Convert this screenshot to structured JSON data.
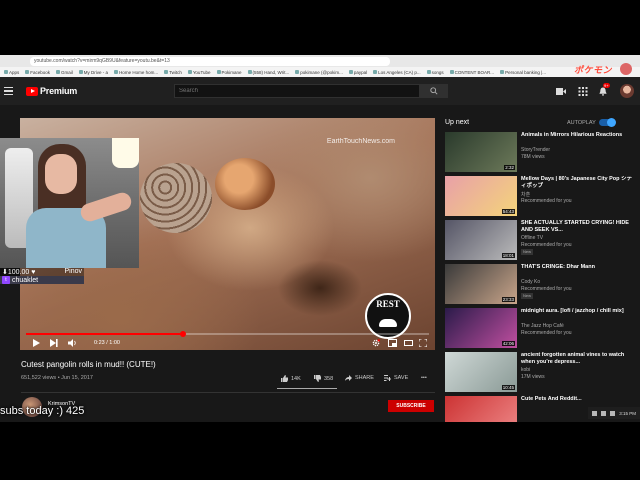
{
  "browser": {
    "url": "youtube.com/watch?v=mirm9qGB9U&feature=youtu.be&t=13",
    "bookmarks": [
      "Apps",
      "Facebook",
      "Gmail",
      "My Drive - a",
      "Home Home hom...",
      "Twitch",
      "YouTube",
      "Pokimane",
      "(558) Hand, Writ...",
      "pokimane (@pokim...",
      "paypal",
      "Los Angeles (CA) p...",
      "songs",
      "CONTENT BOAR...",
      "Personal banking |..."
    ],
    "overlay_logo": "ポケモン"
  },
  "header": {
    "logo": "Premium",
    "search_placeholder": "Search",
    "notification_count": "9+"
  },
  "player": {
    "watermark": "EarthTouchNews.com",
    "rest_logo": "REST",
    "time": "0:23 / 1:00",
    "progress_fraction": 0.39
  },
  "webcam": {
    "donation_amount": "⬇100.00 ♥",
    "donation_name": "Pinov",
    "username": "chuaklet"
  },
  "video": {
    "title": "Cutest pangolin rolls in mud!! (CUTE!)",
    "meta": "651,522 views • Jun 15, 2017",
    "likes": "14K",
    "dislikes": "358",
    "share": "SHARE",
    "save": "SAVE",
    "more": "•••"
  },
  "channel": {
    "name": "KrimsonTV",
    "subscribe": "SUBSCRIBE"
  },
  "overlay": {
    "subs_today": "subs today :) 425"
  },
  "sidebar": {
    "upnext": "Up next",
    "autoplay": "AUTOPLAY",
    "items": [
      {
        "title": "Animals in Mirrors Hilarious Reactions",
        "channel": "StoryTrender",
        "views": "78M views",
        "duration": "2:32",
        "colors": [
          "#2a3a2c",
          "#6d7a5a"
        ]
      },
      {
        "title": "Mellow Days | 80's Japanese City Pop シティポップ",
        "channel": "차훈",
        "views": "Recommended for you",
        "duration": "54:43",
        "colors": [
          "#e8a0a8",
          "#f4d47a"
        ]
      },
      {
        "title": "SHE ACTUALLY STARTED CRYING! HIDE AND SEEK VS...",
        "channel": "Offline TV",
        "views": "Recommended for you",
        "badge": "New",
        "duration": "18:01",
        "colors": [
          "#556",
          "#bbb"
        ]
      },
      {
        "title": "THAT'S CRINGE: Dhar Mann",
        "channel": "Cody Ko",
        "views": "Recommended for you",
        "badge": "New",
        "duration": "23:33",
        "colors": [
          "#3a3a3a",
          "#c9a58a"
        ]
      },
      {
        "title": "midnight aura. [lofi / jazzhop / chill mix]",
        "channel": "The Jazz Hop Café",
        "views": "Recommended for you",
        "duration": "42:06",
        "colors": [
          "#2b1b4a",
          "#c04fa0"
        ]
      },
      {
        "title": "ancient forgotten animal vines to watch when you're depress...",
        "channel": "kobi",
        "views": "17M views",
        "duration": "10:45",
        "colors": [
          "#cfd8d6",
          "#8a9a96"
        ]
      },
      {
        "title": "Cute Pets And Reddit...",
        "channel": "",
        "views": "",
        "duration": "",
        "colors": [
          "#c33",
          "#e88"
        ]
      }
    ]
  },
  "tray": {
    "time": "3:15 PM"
  }
}
